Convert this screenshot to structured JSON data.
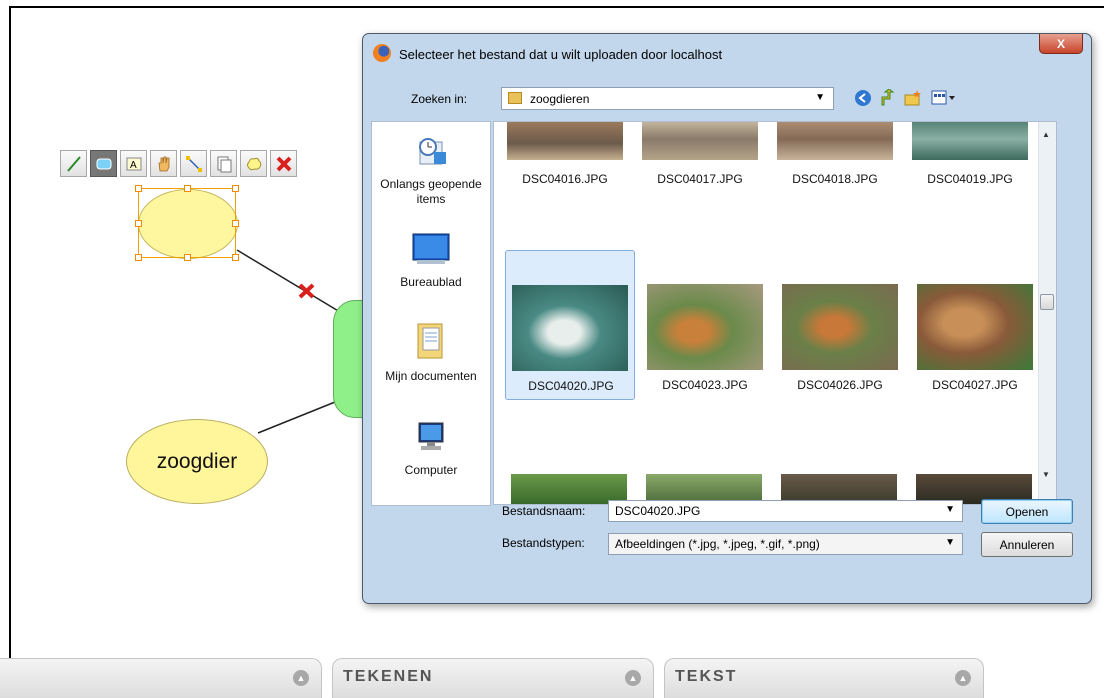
{
  "mindmap": {
    "node_label": "zoogdier",
    "toolbar": [
      "pen",
      "shape",
      "text",
      "hand",
      "connector",
      "copy",
      "cloud",
      "delete"
    ]
  },
  "bottom_tabs": [
    {
      "label": ""
    },
    {
      "label": "TEKENEN"
    },
    {
      "label": "TEKST"
    }
  ],
  "dialog": {
    "title": "Selecteer het bestand dat u wilt uploaden door localhost",
    "close_label": "X",
    "look_in_label": "Zoeken in:",
    "look_in_value": "zoogdieren",
    "places": [
      {
        "label": "Onlangs geopende items",
        "icon": "recent-items-icon"
      },
      {
        "label": "Bureaublad",
        "icon": "desktop-icon"
      },
      {
        "label": "Mijn documenten",
        "icon": "documents-icon"
      },
      {
        "label": "Computer",
        "icon": "computer-icon"
      }
    ],
    "files": [
      {
        "name": "DSC04016.JPG"
      },
      {
        "name": "DSC04017.JPG"
      },
      {
        "name": "DSC04018.JPG"
      },
      {
        "name": "DSC04019.JPG"
      },
      {
        "name": "DSC04020.JPG",
        "selected": true
      },
      {
        "name": "DSC04023.JPG"
      },
      {
        "name": "DSC04026.JPG"
      },
      {
        "name": "DSC04027.JPG"
      }
    ],
    "filename_label": "Bestandsnaam:",
    "filename_value": "DSC04020.JPG",
    "filetype_label": "Bestandstypen:",
    "filetype_value": "Afbeeldingen (*.jpg, *.jpeg, *.gif, *.png)",
    "open_button": "Openen",
    "cancel_button": "Annuleren"
  }
}
